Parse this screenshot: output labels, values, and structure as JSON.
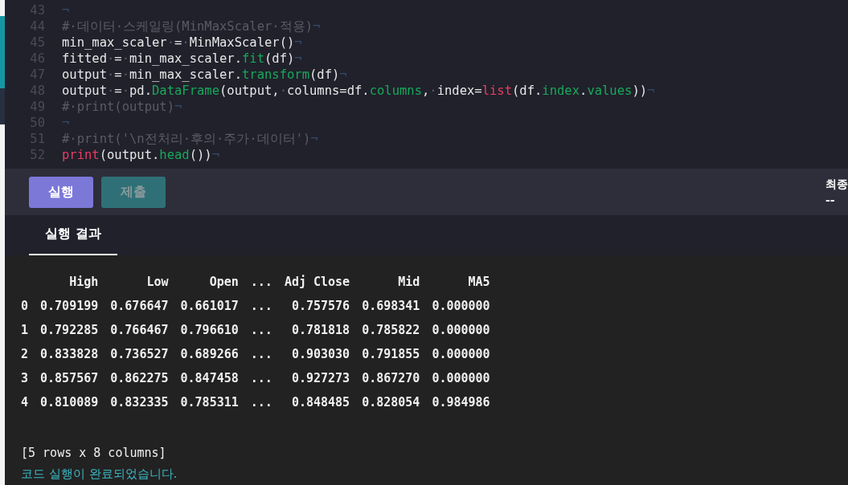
{
  "editor": {
    "lines": [
      {
        "number": "43",
        "tokens": [
          {
            "kind": "eol",
            "text": "¬"
          }
        ]
      },
      {
        "number": "44",
        "tokens": [
          {
            "kind": "comment",
            "text": "#·데이터·스케일링(MinMaxScaler·적용)"
          },
          {
            "kind": "eol",
            "text": "¬"
          }
        ]
      },
      {
        "number": "45",
        "tokens": [
          {
            "kind": "plain",
            "text": "min_max_scaler"
          },
          {
            "kind": "space",
            "text": "·"
          },
          {
            "kind": "plain",
            "text": "="
          },
          {
            "kind": "space",
            "text": "·"
          },
          {
            "kind": "plain",
            "text": "MinMaxScaler()"
          },
          {
            "kind": "eol",
            "text": "¬"
          }
        ]
      },
      {
        "number": "46",
        "tokens": [
          {
            "kind": "plain",
            "text": "fitted"
          },
          {
            "kind": "space",
            "text": "·"
          },
          {
            "kind": "plain",
            "text": "="
          },
          {
            "kind": "space",
            "text": "·"
          },
          {
            "kind": "plain",
            "text": "min_max_scaler."
          },
          {
            "kind": "attr",
            "text": "fit"
          },
          {
            "kind": "plain",
            "text": "(df)"
          },
          {
            "kind": "eol",
            "text": "¬"
          }
        ]
      },
      {
        "number": "47",
        "tokens": [
          {
            "kind": "plain",
            "text": "output"
          },
          {
            "kind": "space",
            "text": "·"
          },
          {
            "kind": "plain",
            "text": "="
          },
          {
            "kind": "space",
            "text": "·"
          },
          {
            "kind": "plain",
            "text": "min_max_scaler."
          },
          {
            "kind": "attr",
            "text": "transform"
          },
          {
            "kind": "plain",
            "text": "(df)"
          },
          {
            "kind": "eol",
            "text": "¬"
          }
        ]
      },
      {
        "number": "48",
        "tokens": [
          {
            "kind": "plain",
            "text": "output"
          },
          {
            "kind": "space",
            "text": "·"
          },
          {
            "kind": "plain",
            "text": "="
          },
          {
            "kind": "space",
            "text": "·"
          },
          {
            "kind": "plain",
            "text": "pd."
          },
          {
            "kind": "attr",
            "text": "DataFrame"
          },
          {
            "kind": "plain",
            "text": "(output,"
          },
          {
            "kind": "space",
            "text": "·"
          },
          {
            "kind": "plain",
            "text": "columns=df."
          },
          {
            "kind": "attr",
            "text": "columns"
          },
          {
            "kind": "plain",
            "text": ","
          },
          {
            "kind": "space",
            "text": "·"
          },
          {
            "kind": "plain",
            "text": "index="
          },
          {
            "kind": "builtin",
            "text": "list"
          },
          {
            "kind": "plain",
            "text": "(df."
          },
          {
            "kind": "attr",
            "text": "index"
          },
          {
            "kind": "plain",
            "text": "."
          },
          {
            "kind": "attr",
            "text": "values"
          },
          {
            "kind": "plain",
            "text": "))"
          },
          {
            "kind": "eol",
            "text": "¬"
          }
        ]
      },
      {
        "number": "49",
        "tokens": [
          {
            "kind": "comment",
            "text": "#·print(output)"
          },
          {
            "kind": "eol",
            "text": "¬"
          }
        ]
      },
      {
        "number": "50",
        "tokens": [
          {
            "kind": "eol",
            "text": "¬"
          }
        ]
      },
      {
        "number": "51",
        "tokens": [
          {
            "kind": "comment",
            "text": "#·print('\\n전처리·후의·주가·데이터')"
          },
          {
            "kind": "eol",
            "text": "¬"
          }
        ]
      },
      {
        "number": "52",
        "tokens": [
          {
            "kind": "builtin",
            "text": "print"
          },
          {
            "kind": "plain",
            "text": "(output."
          },
          {
            "kind": "attr",
            "text": "head"
          },
          {
            "kind": "plain",
            "text": "())"
          },
          {
            "kind": "eol",
            "text": "¬"
          }
        ]
      }
    ]
  },
  "toolbar": {
    "buttons": [
      {
        "label": "실행",
        "disabled": false
      },
      {
        "label": "제출",
        "disabled": true
      }
    ],
    "final_label": "최종",
    "final_value": "--"
  },
  "tabs": [
    {
      "label": "실행 결과",
      "selected": true
    }
  ],
  "output": {
    "table": {
      "columns": [
        "High",
        "Low",
        "Open",
        "...",
        "Adj Close",
        "Mid",
        "MA5"
      ],
      "rows": [
        {
          "index": "0",
          "values": [
            "0.709199",
            "0.676647",
            "0.661017",
            "...",
            "0.757576",
            "0.698341",
            "0.000000"
          ]
        },
        {
          "index": "1",
          "values": [
            "0.792285",
            "0.766467",
            "0.796610",
            "...",
            "0.781818",
            "0.785822",
            "0.000000"
          ]
        },
        {
          "index": "2",
          "values": [
            "0.833828",
            "0.736527",
            "0.689266",
            "...",
            "0.903030",
            "0.791855",
            "0.000000"
          ]
        },
        {
          "index": "3",
          "values": [
            "0.857567",
            "0.862275",
            "0.847458",
            "...",
            "0.927273",
            "0.867270",
            "0.000000"
          ]
        },
        {
          "index": "4",
          "values": [
            "0.810089",
            "0.832335",
            "0.785311",
            "...",
            "0.848485",
            "0.828054",
            "0.984986"
          ]
        }
      ]
    },
    "summary": "[5 rows x 8 columns]",
    "status": "코드 실행이 완료되었습니다."
  }
}
